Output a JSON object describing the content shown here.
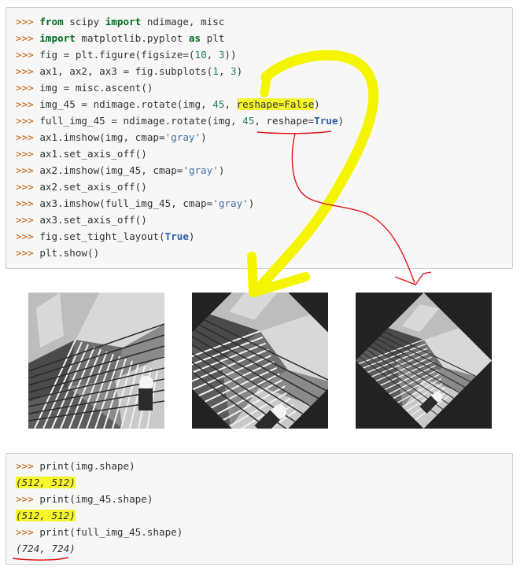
{
  "prompt": ">>>",
  "code_lines": [
    {
      "parts": [
        [
          "p",
          ">>> "
        ],
        [
          "kw",
          "from"
        ],
        [
          "t",
          " scipy "
        ],
        [
          "kw",
          "import"
        ],
        [
          "t",
          " ndimage, misc"
        ]
      ]
    },
    {
      "parts": [
        [
          "p",
          ">>> "
        ],
        [
          "kw",
          "import"
        ],
        [
          "t",
          " matplotlib.pyplot "
        ],
        [
          "kw",
          "as"
        ],
        [
          "t",
          " plt"
        ]
      ]
    },
    {
      "parts": [
        [
          "p",
          ">>> "
        ],
        [
          "t",
          "fig = plt.figure(figsize=("
        ],
        [
          "n",
          "10"
        ],
        [
          "t",
          ", "
        ],
        [
          "n",
          "3"
        ],
        [
          "t",
          "))"
        ]
      ]
    },
    {
      "parts": [
        [
          "p",
          ">>> "
        ],
        [
          "t",
          "ax1, ax2, ax3 = fig.subplots("
        ],
        [
          "n",
          "1"
        ],
        [
          "t",
          ", "
        ],
        [
          "n",
          "3"
        ],
        [
          "t",
          ")"
        ]
      ]
    },
    {
      "parts": [
        [
          "p",
          ">>> "
        ],
        [
          "t",
          "img = misc.ascent()"
        ]
      ]
    },
    {
      "parts": [
        [
          "p",
          ">>> "
        ],
        [
          "t",
          "img_45 = ndimage.rotate(img, "
        ],
        [
          "n",
          "45"
        ],
        [
          "t",
          ", "
        ],
        [
          "hl",
          "reshape=False"
        ],
        [
          "t",
          ")"
        ]
      ]
    },
    {
      "parts": [
        [
          "p",
          ">>> "
        ],
        [
          "t",
          "full_img_45 = ndimage.rotate(img, "
        ],
        [
          "n",
          "45"
        ],
        [
          "t",
          ", reshape="
        ],
        [
          "kwb",
          "True"
        ],
        [
          "t",
          ")"
        ]
      ]
    },
    {
      "parts": [
        [
          "p",
          ">>> "
        ],
        [
          "t",
          "ax1.imshow(img, cmap="
        ],
        [
          "s",
          "'gray'"
        ],
        [
          "t",
          ")"
        ]
      ]
    },
    {
      "parts": [
        [
          "p",
          ">>> "
        ],
        [
          "t",
          "ax1.set_axis_off()"
        ]
      ]
    },
    {
      "parts": [
        [
          "p",
          ">>> "
        ],
        [
          "t",
          "ax2.imshow(img_45, cmap="
        ],
        [
          "s",
          "'gray'"
        ],
        [
          "t",
          ")"
        ]
      ]
    },
    {
      "parts": [
        [
          "p",
          ">>> "
        ],
        [
          "t",
          "ax2.set_axis_off()"
        ]
      ]
    },
    {
      "parts": [
        [
          "p",
          ">>> "
        ],
        [
          "t",
          "ax3.imshow(full_img_45, cmap="
        ],
        [
          "s",
          "'gray'"
        ],
        [
          "t",
          ")"
        ]
      ]
    },
    {
      "parts": [
        [
          "p",
          ">>> "
        ],
        [
          "t",
          "ax3.set_axis_off()"
        ]
      ]
    },
    {
      "parts": [
        [
          "p",
          ">>> "
        ],
        [
          "t",
          "fig.set_tight_layout("
        ],
        [
          "kwb",
          "True"
        ],
        [
          "t",
          ")"
        ]
      ]
    },
    {
      "parts": [
        [
          "p",
          ">>> "
        ],
        [
          "t",
          "plt.show()"
        ]
      ]
    }
  ],
  "output_lines": [
    {
      "parts": [
        [
          "p",
          ">>> "
        ],
        [
          "t",
          "print(img.shape)"
        ]
      ]
    },
    {
      "parts": [
        [
          "ohl",
          "(512, 512)"
        ]
      ]
    },
    {
      "parts": [
        [
          "p",
          ">>> "
        ],
        [
          "t",
          "print(img_45.shape)"
        ]
      ]
    },
    {
      "parts": [
        [
          "ohl",
          "(512, 512)"
        ]
      ]
    },
    {
      "parts": [
        [
          "p",
          ">>> "
        ],
        [
          "t",
          "print(full_img_45.shape)"
        ]
      ]
    },
    {
      "parts": [
        [
          "o",
          "(724, 724)"
        ]
      ]
    }
  ],
  "images": [
    {
      "name": "original-ascent-image"
    },
    {
      "name": "rotated-45-no-reshape-image"
    },
    {
      "name": "rotated-45-reshape-image"
    }
  ],
  "colors": {
    "highlight": "#f5f72a",
    "annotation_yellow": "#f5f500",
    "annotation_red": "#e0191b",
    "image_background": "#222222"
  }
}
